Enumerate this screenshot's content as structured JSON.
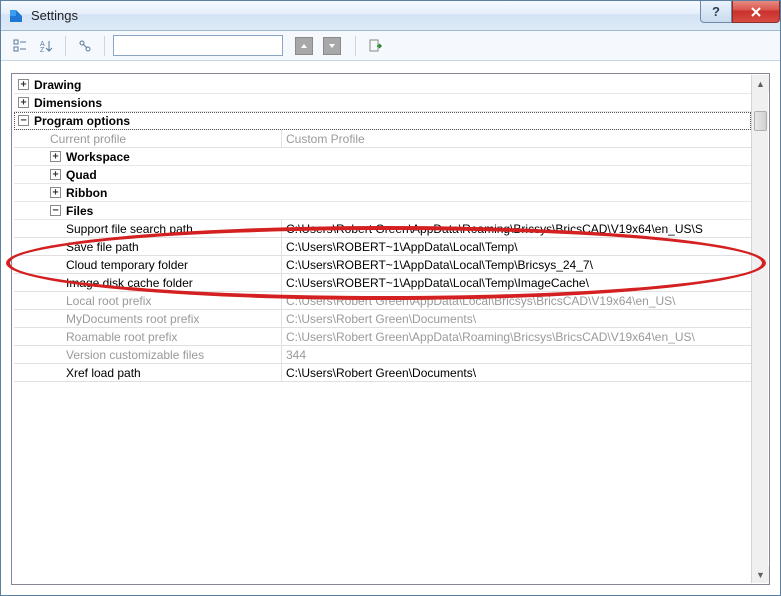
{
  "window": {
    "title": "Settings"
  },
  "toolbar": {
    "search_placeholder": ""
  },
  "tree": {
    "drawing": "Drawing",
    "dimensions": "Dimensions",
    "program_options": "Program options",
    "current_profile": {
      "label": "Current profile",
      "value": "Custom Profile"
    },
    "workspace": "Workspace",
    "quad": "Quad",
    "ribbon": "Ribbon",
    "files": "Files",
    "rows": [
      {
        "label": "Support file search path",
        "value": "C:\\Users\\Robert Green\\AppData\\Roaming\\Bricsys\\BricsCAD\\V19x64\\en_US\\S",
        "gray": false
      },
      {
        "label": "Save file path",
        "value": "C:\\Users\\ROBERT~1\\AppData\\Local\\Temp\\",
        "gray": false
      },
      {
        "label": "Cloud temporary folder",
        "value": "C:\\Users\\ROBERT~1\\AppData\\Local\\Temp\\Bricsys_24_7\\",
        "gray": false
      },
      {
        "label": "Image disk cache folder",
        "value": "C:\\Users\\ROBERT~1\\AppData\\Local\\Temp\\ImageCache\\",
        "gray": false
      },
      {
        "label": "Local root prefix",
        "value": "C:\\Users\\Robert Green\\AppData\\Local\\Bricsys\\BricsCAD\\V19x64\\en_US\\",
        "gray": true
      },
      {
        "label": "MyDocuments root prefix",
        "value": "C:\\Users\\Robert Green\\Documents\\",
        "gray": true
      },
      {
        "label": "Roamable root prefix",
        "value": "C:\\Users\\Robert Green\\AppData\\Roaming\\Bricsys\\BricsCAD\\V19x64\\en_US\\",
        "gray": true
      },
      {
        "label": "Version customizable files",
        "value": "344",
        "gray": true
      },
      {
        "label": "Xref load path",
        "value": "C:\\Users\\Robert Green\\Documents\\",
        "gray": false
      }
    ]
  }
}
